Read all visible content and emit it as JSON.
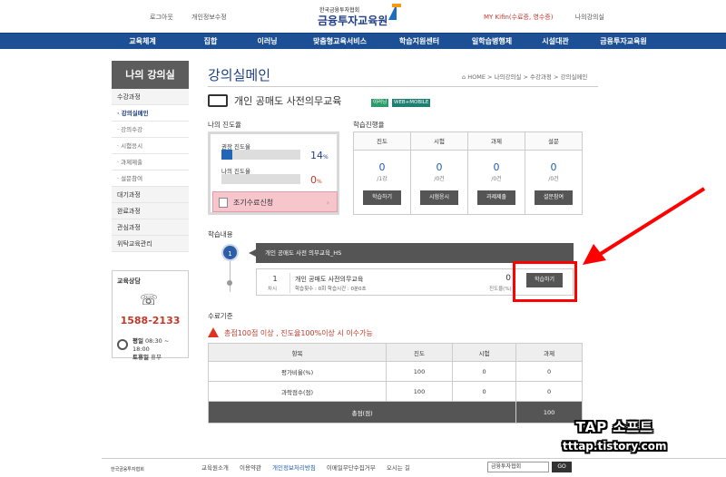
{
  "header": {
    "links": [
      "로그아웃",
      "개인정보수정"
    ],
    "logo_small": "한국금융투자협회",
    "logo_big": "금융투자교육원",
    "my_kifin": "MY Kifin(수료증, 영수증)",
    "my_classroom": "나의강의실"
  },
  "nav": [
    "교육체계",
    "집합",
    "이러닝",
    "맞춤형교육서비스",
    "학습지원센터",
    "일학습병행제",
    "시설대관",
    "금융투자교육원"
  ],
  "sidebar": {
    "title": "나의 강의실",
    "items": [
      {
        "label": "수강과정",
        "type": "grp"
      },
      {
        "label": "· 강의실메인",
        "type": "sub active"
      },
      {
        "label": "· 강의수강",
        "type": "sub"
      },
      {
        "label": "· 시험응시",
        "type": "sub"
      },
      {
        "label": "· 과제제출",
        "type": "sub"
      },
      {
        "label": "· 설문참여",
        "type": "sub"
      },
      {
        "label": "대기과정",
        "type": "grp"
      },
      {
        "label": "완료과정",
        "type": "grp"
      },
      {
        "label": "관심과정",
        "type": "grp"
      },
      {
        "label": "위탁교육관리",
        "type": "grp"
      }
    ],
    "consult_title": "교육상담",
    "phone": "1588-2133",
    "weekday": "평일",
    "weekday_hours": "08:30 ~ 18:00",
    "saturday": "토휴일",
    "saturday_hours": "휴무"
  },
  "page": {
    "title": "강의실메인",
    "breadcrumb": "HOME > 나의강의실 > 수강과정 > 강의실메인",
    "course_title": "개인 공매도 사전의무교육",
    "tag1": "이러닝",
    "tag2": "WEB+MOBILE"
  },
  "progress": {
    "label": "나의 진도율",
    "recommended_label": "권장 진도율",
    "recommended_value": "14",
    "recommended_fraction": 0.14,
    "mine_label": "나의 진도율",
    "mine_value": "0",
    "mine_fraction": 0,
    "unit": "%",
    "early_button": "조기수료신청"
  },
  "status": {
    "label": "학습진행율",
    "columns": [
      {
        "header": "진도",
        "value": "0",
        "sub": "/1강",
        "button": "학습하기"
      },
      {
        "header": "시험",
        "value": "0",
        "sub": "/0건",
        "button": "시험응시"
      },
      {
        "header": "과제",
        "value": "0",
        "sub": "/0건",
        "button": "과제제출"
      },
      {
        "header": "설문",
        "value": "0",
        "sub": "/0건",
        "button": "설문참여"
      }
    ]
  },
  "learning": {
    "label": "학습내용",
    "chapter_num": "1",
    "chapter_title": "개인 공매도 사전 의무교육_HS",
    "lesson_num": "1",
    "lesson_unit": "차시",
    "lesson_title": "개인 공매도 사전의무교육",
    "lesson_meta": "학습횟수 : 0회  학습시간 : 0분0초",
    "lesson_progress": "0",
    "lesson_progress_label": "진도율(%)",
    "study_button": "학습하기"
  },
  "criteria": {
    "label": "수료기준",
    "note": "총점100점 이상 , 진도율100%이상 시 이수가능",
    "headers": [
      "항목",
      "진도",
      "시험",
      "과제"
    ],
    "rows": [
      [
        "평가비율(%)",
        "100",
        "0",
        "0"
      ],
      [
        "과락점수(점)",
        "100",
        "0",
        "0"
      ]
    ],
    "total_label": "총점(점)",
    "total_value": "100"
  },
  "footer": {
    "links": [
      "교육원소개",
      "이용약관",
      "개인정보처리방침",
      "이메일무단수집거부",
      "오시는 길"
    ],
    "logo_text": "한국금융투자협회",
    "select_value": "금융투자협회",
    "go": "GO"
  },
  "watermark": {
    "line1": "TAP 소프트",
    "line2": "tttap.tistory.com"
  },
  "colors": {
    "nav": "#1d4f95",
    "accent": "#1f3f86",
    "highlight": "#ff0000",
    "early_btn": "#f7c6cd"
  }
}
